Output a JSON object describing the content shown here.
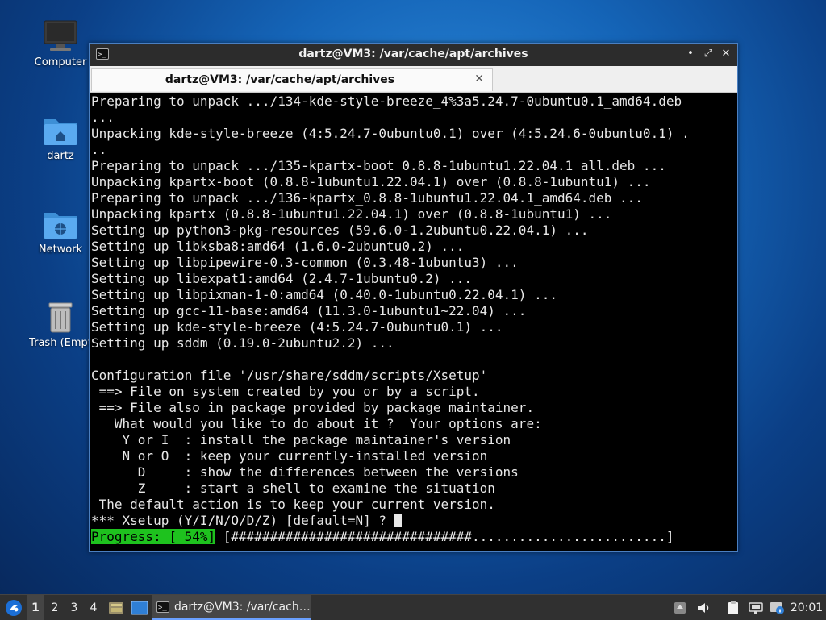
{
  "desktop": {
    "icons": [
      {
        "label": "Computer"
      },
      {
        "label": "dartz"
      },
      {
        "label": "Network"
      },
      {
        "label": "Trash (Empt"
      }
    ]
  },
  "window": {
    "title": "dartz@VM3: /var/cache/apt/archives",
    "tab_label": "dartz@VM3: /var/cache/apt/archives"
  },
  "terminal": {
    "lines": [
      "Preparing to unpack .../134-kde-style-breeze_4%3a5.24.7-0ubuntu0.1_amd64.deb",
      "...",
      "Unpacking kde-style-breeze (4:5.24.7-0ubuntu0.1) over (4:5.24.6-0ubuntu0.1) .",
      "..",
      "Preparing to unpack .../135-kpartx-boot_0.8.8-1ubuntu1.22.04.1_all.deb ...",
      "Unpacking kpartx-boot (0.8.8-1ubuntu1.22.04.1) over (0.8.8-1ubuntu1) ...",
      "Preparing to unpack .../136-kpartx_0.8.8-1ubuntu1.22.04.1_amd64.deb ...",
      "Unpacking kpartx (0.8.8-1ubuntu1.22.04.1) over (0.8.8-1ubuntu1) ...",
      "Setting up python3-pkg-resources (59.6.0-1.2ubuntu0.22.04.1) ...",
      "Setting up libksba8:amd64 (1.6.0-2ubuntu0.2) ...",
      "Setting up libpipewire-0.3-common (0.3.48-1ubuntu3) ...",
      "Setting up libexpat1:amd64 (2.4.7-1ubuntu0.2) ...",
      "Setting up libpixman-1-0:amd64 (0.40.0-1ubuntu0.22.04.1) ...",
      "Setting up gcc-11-base:amd64 (11.3.0-1ubuntu1~22.04) ...",
      "Setting up kde-style-breeze (4:5.24.7-0ubuntu0.1) ...",
      "Setting up sddm (0.19.0-2ubuntu2.2) ...",
      "",
      "Configuration file '/usr/share/sddm/scripts/Xsetup'",
      " ==> File on system created by you or by a script.",
      " ==> File also in package provided by package maintainer.",
      "   What would you like to do about it ?  Your options are:",
      "    Y or I  : install the package maintainer's version",
      "    N or O  : keep your currently-installed version",
      "      D     : show the differences between the versions",
      "      Z     : start a shell to examine the situation",
      " The default action is to keep your current version."
    ],
    "prompt": "*** Xsetup (Y/I/N/O/D/Z) [default=N] ? ",
    "progress_label": "Progress: [ 54%]",
    "progress_bar": " [###############################.........................]",
    "progress_percent": 54
  },
  "taskbar": {
    "workspaces": [
      "1",
      "2",
      "3",
      "4"
    ],
    "active_workspace": "1",
    "task_label": "dartz@VM3: /var/cach…",
    "clock": "20:01"
  },
  "colors": {
    "progress_green": "#1ec21e",
    "taskbar_bg": "#303030",
    "window_border": "#4a7fc1"
  }
}
